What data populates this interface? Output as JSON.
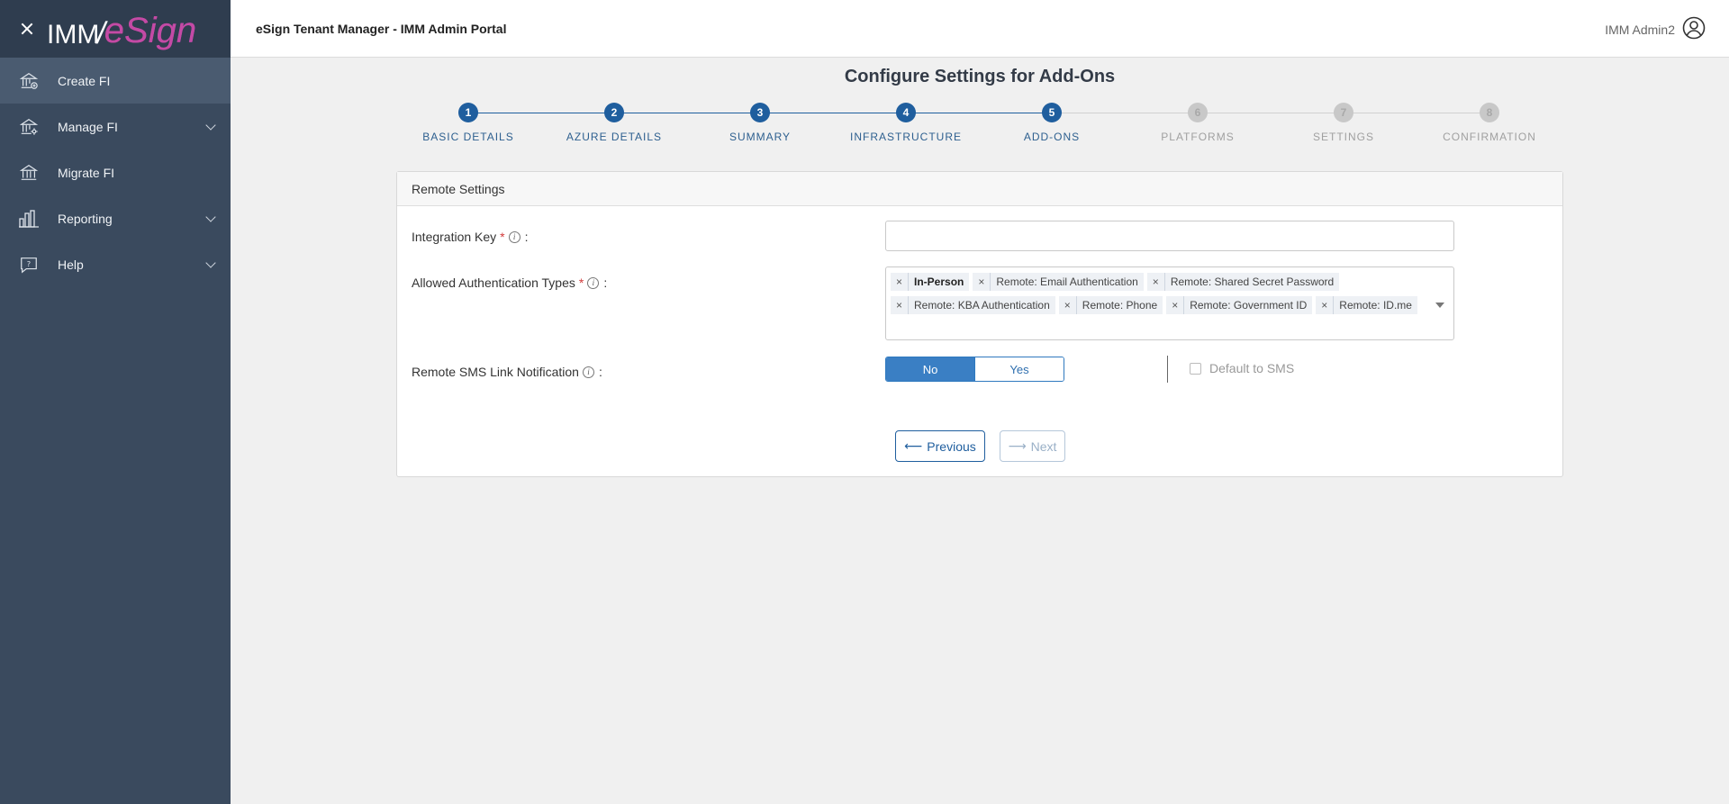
{
  "colors": {
    "sidebar_bg": "#3a4a5e",
    "accent": "#1f5e9e",
    "step_done": "#1f5e9e",
    "step_pending": "#c8c8c8",
    "required": "#d23b3b"
  },
  "logo": {
    "part1": "IMM",
    "slash": "/",
    "part2": "eSign"
  },
  "sidebar": {
    "items": [
      {
        "label": "Create FI",
        "icon": "bank-add-icon",
        "expandable": false,
        "active": true
      },
      {
        "label": "Manage FI",
        "icon": "bank-gear-icon",
        "expandable": true
      },
      {
        "label": "Migrate FI",
        "icon": "bank-icon",
        "expandable": false
      },
      {
        "label": "Reporting",
        "icon": "bar-chart-icon",
        "expandable": true
      },
      {
        "label": "Help",
        "icon": "help-chat-icon",
        "expandable": true
      }
    ]
  },
  "header": {
    "title": "eSign Tenant Manager - IMM Admin Portal",
    "user": "IMM Admin2"
  },
  "page": {
    "title": "Configure Settings for Add-Ons"
  },
  "steps": [
    {
      "number": "1",
      "label": "BASIC DETAILS",
      "status": "completed"
    },
    {
      "number": "2",
      "label": "AZURE DETAILS",
      "status": "completed"
    },
    {
      "number": "3",
      "label": "SUMMARY",
      "status": "completed"
    },
    {
      "number": "4",
      "label": "INFRASTRUCTURE",
      "status": "completed"
    },
    {
      "number": "5",
      "label": "ADD-ONS",
      "status": "current"
    },
    {
      "number": "6",
      "label": "PLATFORMS",
      "status": "pending"
    },
    {
      "number": "7",
      "label": "SETTINGS",
      "status": "pending"
    },
    {
      "number": "8",
      "label": "CONFIRMATION",
      "status": "pending"
    }
  ],
  "remote_settings": {
    "header": "Remote Settings",
    "integration_key": {
      "label": "Integration Key",
      "required": "*",
      "info": "i",
      "colon": ":",
      "value": ""
    },
    "auth_types": {
      "label": "Allowed Authentication Types",
      "required": "*",
      "info": "i",
      "colon": ":",
      "remove_glyph": "×",
      "selected": [
        "In-Person",
        "Remote: Email Authentication",
        "Remote: Shared Secret Password",
        "Remote: KBA Authentication",
        "Remote: Phone",
        "Remote: Government ID",
        "Remote: ID.me"
      ]
    },
    "sms_link": {
      "label": "Remote SMS Link Notification",
      "info": "i",
      "colon": ":",
      "option_no": "No",
      "option_yes": "Yes",
      "selected": "No",
      "default_to_sms_label": "Default to SMS",
      "default_to_sms_checked": false
    }
  },
  "buttons": {
    "previous": "Previous",
    "previous_arrow": "⟵",
    "next": "Next",
    "next_arrow": "⟶"
  }
}
